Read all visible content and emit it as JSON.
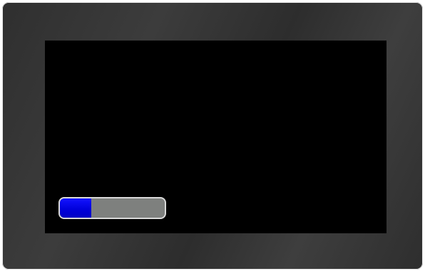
{
  "device": {
    "frame_color": "#333333",
    "screen_color": "#000000"
  },
  "progress": {
    "value_fraction": 0.3,
    "fill_color": "#0000e0",
    "track_color": "#7e807e",
    "border_color": "#d9d9d9"
  }
}
